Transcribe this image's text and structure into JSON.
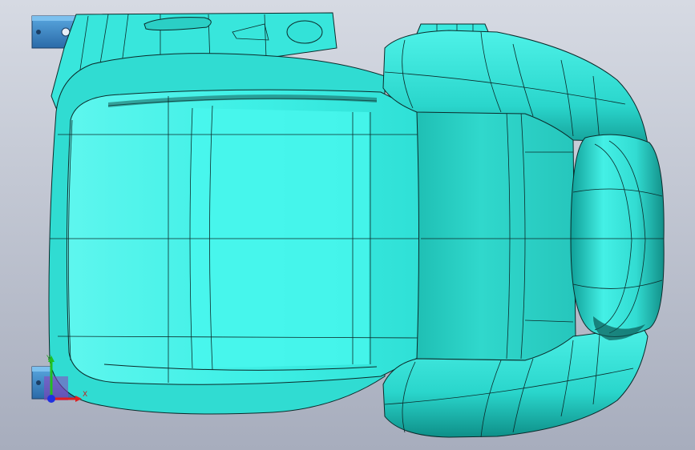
{
  "viewport": {
    "background_top": "#d4d8e2",
    "background_bottom": "#a9afbf",
    "model_color": "#3ff0e6",
    "model_shadow_color": "#22c8c0",
    "edge_color": "#0b2a2a",
    "bracket_color": "#2f7fc0"
  },
  "triad": {
    "x_label": "X",
    "y_label": "Y",
    "x_color": "#e02020",
    "y_color": "#20c020",
    "z_color": "#2020e0"
  }
}
